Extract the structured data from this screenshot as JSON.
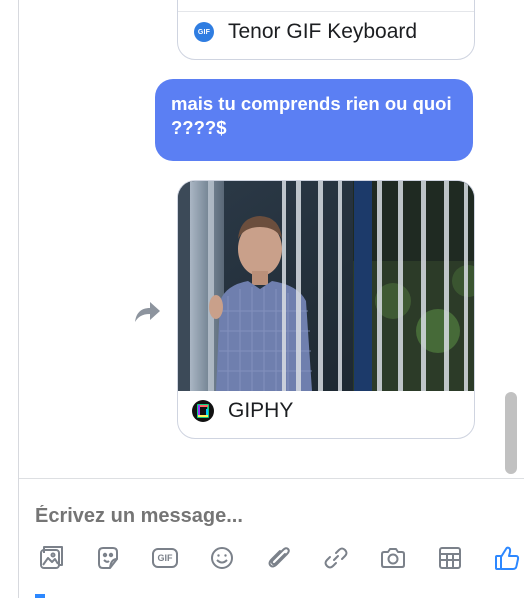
{
  "conversation": {
    "messages": [
      {
        "type": "gif",
        "source_label": "Tenor GIF Keyboard",
        "logo_text": "GIF",
        "outgoing": true
      },
      {
        "type": "text",
        "text": "mais tu comprends rien ou quoi ????$",
        "outgoing": true
      },
      {
        "type": "gif",
        "source_label": "GIPHY",
        "outgoing": true
      }
    ]
  },
  "composer": {
    "placeholder": "Écrivez un message...",
    "gif_button_text": "GIF",
    "toolbar_icons": [
      "photo-icon",
      "sticker-icon",
      "gif-icon",
      "emoji-icon",
      "attachment-icon",
      "link-icon",
      "camera-icon",
      "table-icon",
      "like-icon"
    ]
  },
  "colors": {
    "bubble": "#5b7ff3",
    "icon_gray": "#7b818a",
    "like_blue": "#2d88ff",
    "tenor_blue": "#2f7de1"
  }
}
